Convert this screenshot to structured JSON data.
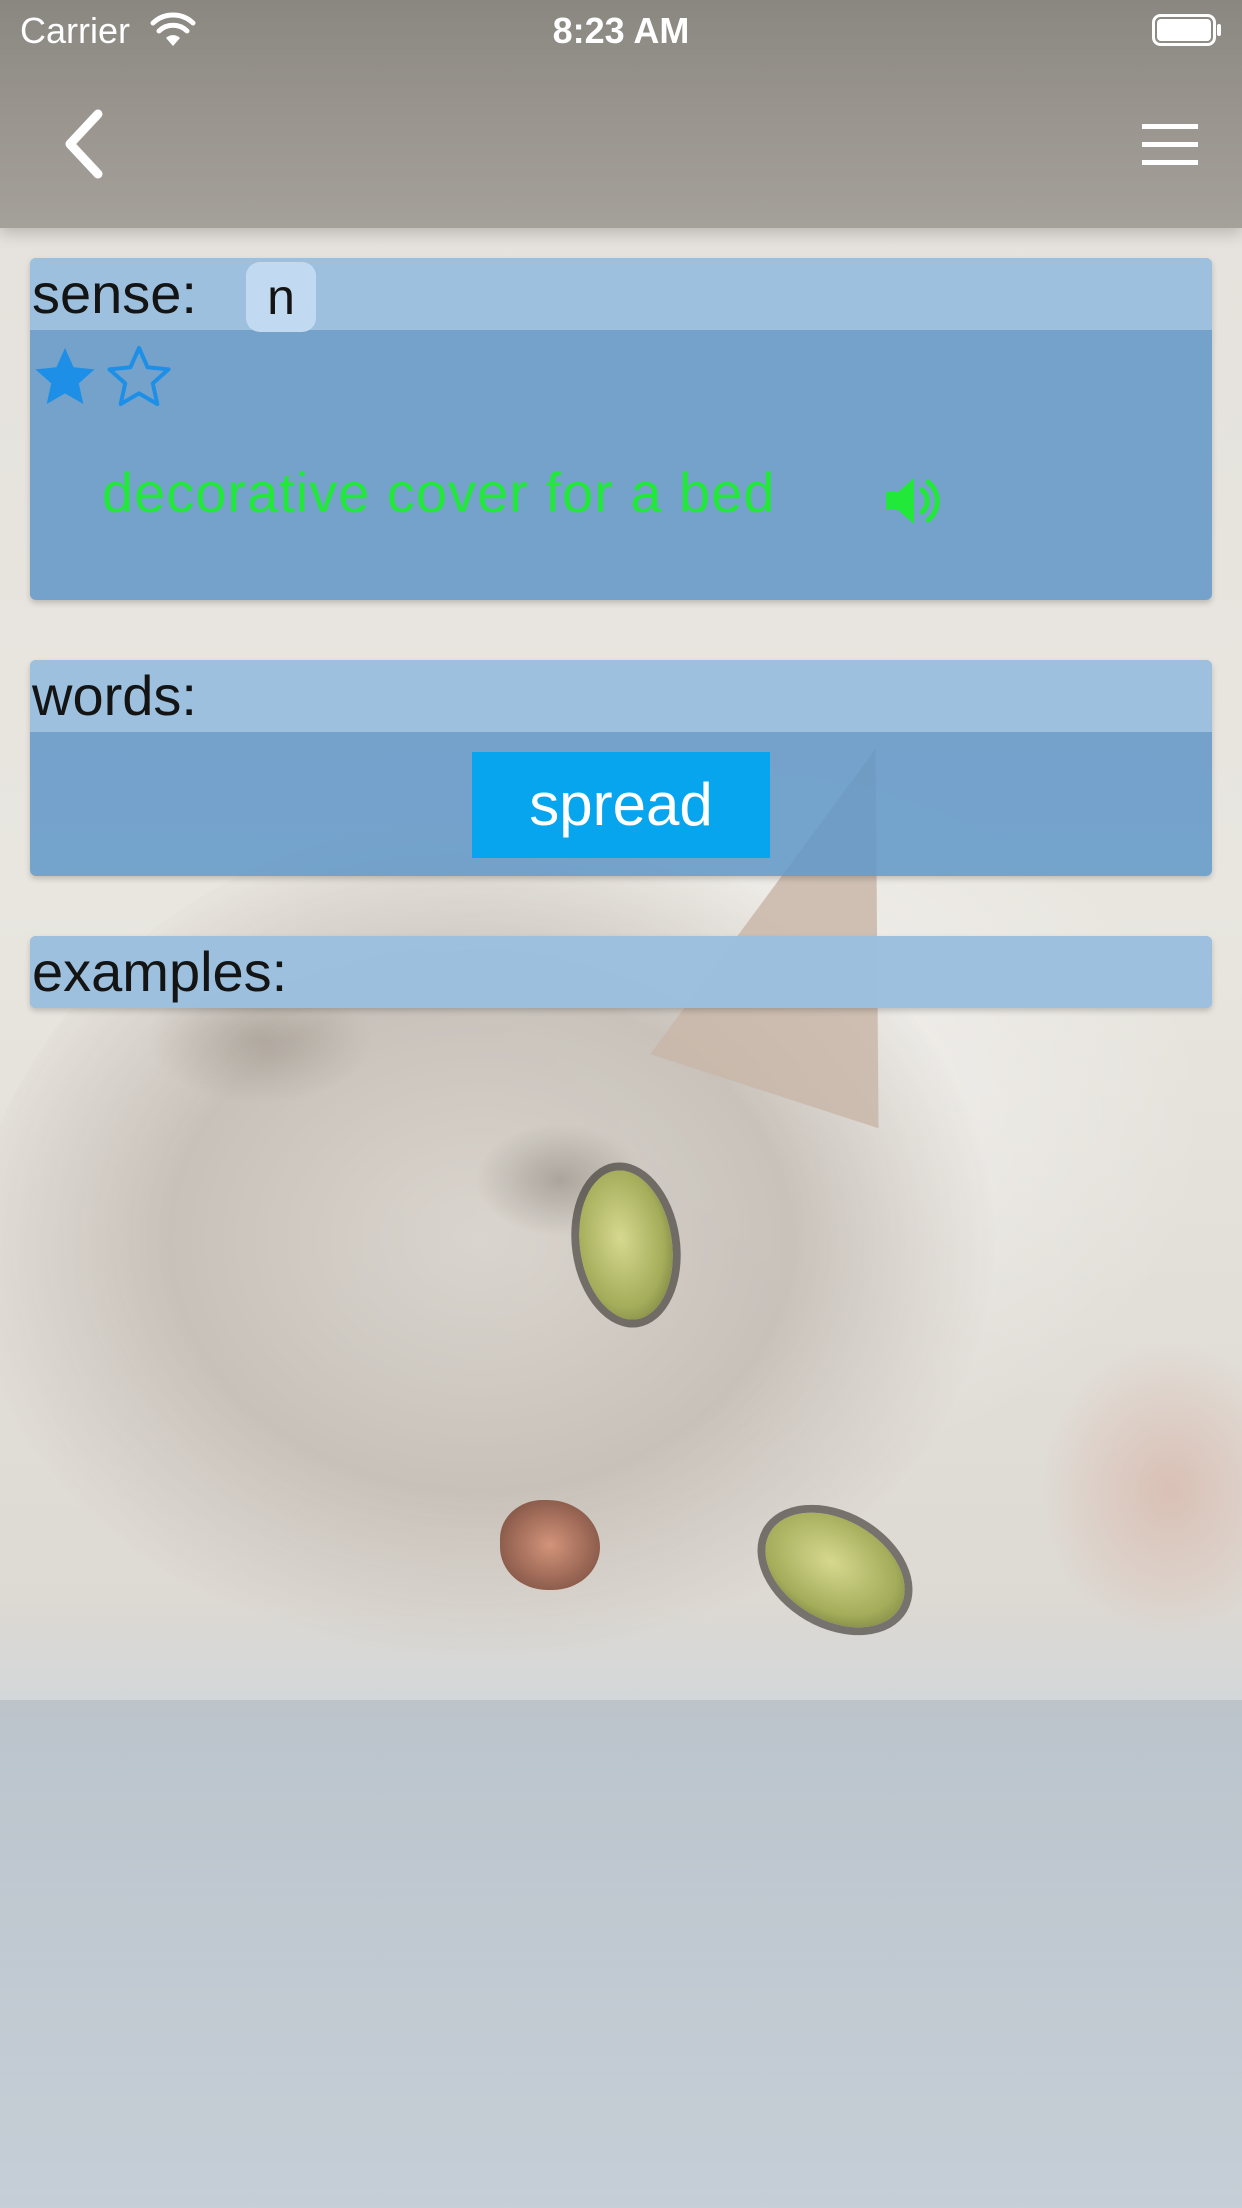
{
  "status_bar": {
    "carrier": "Carrier",
    "time": "8:23 AM"
  },
  "nav": {
    "back_icon": "chevron-left-icon",
    "menu_icon": "hamburger-menu-icon"
  },
  "sense": {
    "label": "sense:",
    "part_of_speech": "n",
    "rating": {
      "filled": 1,
      "total": 2
    },
    "definition": "decorative cover for a bed",
    "speaker_icon": "speaker-icon",
    "definition_color": "#22e83a"
  },
  "words": {
    "label": "words:",
    "items": [
      "spread"
    ]
  },
  "examples": {
    "label": "examples:"
  },
  "colors": {
    "panel": "#5f96c8",
    "panel_header": "#a0c2de",
    "star": "#1e8fe6",
    "word_chip": "#06a5ee"
  },
  "background": {
    "description_icon": "cat-photo"
  }
}
